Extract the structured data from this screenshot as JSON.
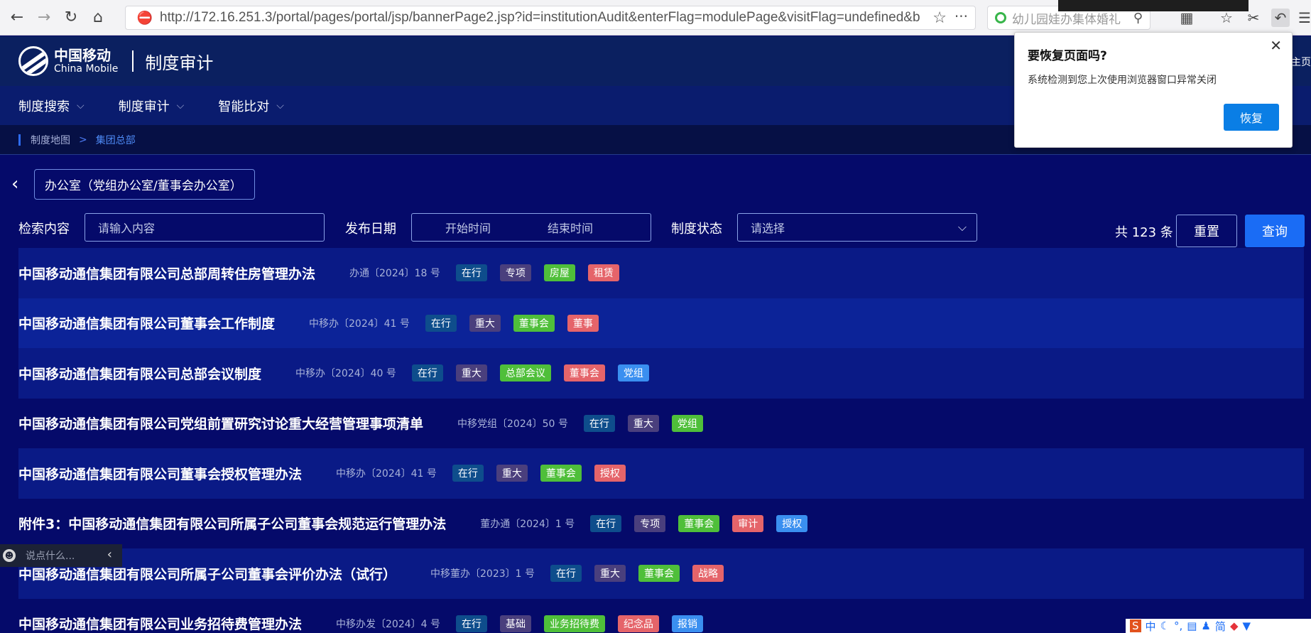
{
  "browser": {
    "url": "http://172.16.251.3/portal/pages/portal/jsp/bannerPage2.jsp?id=institutionAudit&enterFlag=modulePage&visitFlag=undefined&b",
    "search_placeholder": "幼儿园娃办集体婚礼",
    "back_icon": "←",
    "forward_icon": "→",
    "reload_icon": "↻",
    "home_icon": "⌂",
    "star_icon": "☆",
    "more_icon": "···"
  },
  "header": {
    "brand_cn": "中国移动",
    "brand_en": "China Mobile",
    "app_title": "制度审计",
    "right_text": "主页"
  },
  "menu": {
    "items": [
      {
        "label": "制度搜索"
      },
      {
        "label": "制度审计"
      },
      {
        "label": "智能比对"
      }
    ],
    "chevron": "⌵"
  },
  "breadcrumb": {
    "root": "制度地图",
    "sep": ">",
    "current": "集团总部"
  },
  "dept": {
    "value": "办公室（党组办公室/董事会办公室）",
    "back_icon": "‹"
  },
  "filters": {
    "search_label": "检索内容",
    "search_placeholder": "请输入内容",
    "date_label": "发布日期",
    "date_start": "开始时间",
    "date_end": "结束时间",
    "status_label": "制度状态",
    "status_placeholder": "请选择",
    "count_text": "共 123 条",
    "reset_label": "重置",
    "query_label": "查询"
  },
  "colors": {
    "tag_zaihang": "#0e4d8c",
    "tag_purple": "#4a3f7d",
    "tag_green": "#4fbf3a",
    "tag_red": "#e5646a",
    "tag_blue": "#3a8ff0"
  },
  "rows": [
    {
      "title": "中国移动通信集团有限公司总部周转住房管理办法",
      "code": "办通〔2024〕18 号",
      "tags": [
        {
          "t": "在行",
          "c": "#0e4d8c"
        },
        {
          "t": "专项",
          "c": "#4a3f7d"
        },
        {
          "t": "房屋",
          "c": "#4fbf3a"
        },
        {
          "t": "租赁",
          "c": "#e5646a"
        }
      ]
    },
    {
      "title": "中国移动通信集团有限公司董事会工作制度",
      "code": "中移办〔2024〕41 号",
      "tags": [
        {
          "t": "在行",
          "c": "#0e4d8c"
        },
        {
          "t": "重大",
          "c": "#4a3f7d"
        },
        {
          "t": "董事会",
          "c": "#4fbf3a"
        },
        {
          "t": "董事",
          "c": "#e5646a"
        }
      ]
    },
    {
      "title": "中国移动通信集团有限公司总部会议制度",
      "code": "中移办〔2024〕40 号",
      "tags": [
        {
          "t": "在行",
          "c": "#0e4d8c"
        },
        {
          "t": "重大",
          "c": "#4a3f7d"
        },
        {
          "t": "总部会议",
          "c": "#4fbf3a"
        },
        {
          "t": "董事会",
          "c": "#e5646a"
        },
        {
          "t": "党组",
          "c": "#3a8ff0"
        }
      ]
    },
    {
      "title": "中国移动通信集团有限公司党组前置研究讨论重大经营管理事项清单",
      "code": "中移党组〔2024〕50 号",
      "tags": [
        {
          "t": "在行",
          "c": "#0e4d8c"
        },
        {
          "t": "重大",
          "c": "#4a3f7d"
        },
        {
          "t": "党组",
          "c": "#4fbf3a"
        }
      ]
    },
    {
      "title": "中国移动通信集团有限公司董事会授权管理办法",
      "code": "中移办〔2024〕41 号",
      "tags": [
        {
          "t": "在行",
          "c": "#0e4d8c"
        },
        {
          "t": "重大",
          "c": "#4a3f7d"
        },
        {
          "t": "董事会",
          "c": "#4fbf3a"
        },
        {
          "t": "授权",
          "c": "#e5646a"
        }
      ]
    },
    {
      "title": "附件3：中国移动通信集团有限公司所属子公司董事会规范运行管理办法",
      "code": "董办通〔2024〕1 号",
      "tags": [
        {
          "t": "在行",
          "c": "#0e4d8c"
        },
        {
          "t": "专项",
          "c": "#4a3f7d"
        },
        {
          "t": "董事会",
          "c": "#4fbf3a"
        },
        {
          "t": "审计",
          "c": "#e5646a"
        },
        {
          "t": "授权",
          "c": "#3a8ff0"
        }
      ]
    },
    {
      "title": "中国移动通信集团有限公司所属子公司董事会评价办法（试行）",
      "code": "中移董办〔2023〕1 号",
      "tags": [
        {
          "t": "在行",
          "c": "#0e4d8c"
        },
        {
          "t": "重大",
          "c": "#4a3f7d"
        },
        {
          "t": "董事会",
          "c": "#4fbf3a"
        },
        {
          "t": "战略",
          "c": "#e5646a"
        }
      ]
    },
    {
      "title": "中国移动通信集团有限公司业务招待费管理办法",
      "code": "中移办发〔2024〕4 号",
      "tags": [
        {
          "t": "在行",
          "c": "#0e4d8c"
        },
        {
          "t": "基础",
          "c": "#4a3f7d"
        },
        {
          "t": "业务招待费",
          "c": "#4fbf3a"
        },
        {
          "t": "纪念品",
          "c": "#e5646a"
        },
        {
          "t": "报销",
          "c": "#3a8ff0"
        }
      ]
    }
  ],
  "popup": {
    "title": "要恢复页面吗?",
    "message": "系统检测到您上次使用浏览器窗口异常关闭",
    "button": "恢复",
    "close_icon": "✕"
  },
  "chat": {
    "placeholder": "说点什么...",
    "arrow": "‹",
    "smile": "☻"
  },
  "ime": {
    "items": [
      "中",
      "简"
    ]
  }
}
